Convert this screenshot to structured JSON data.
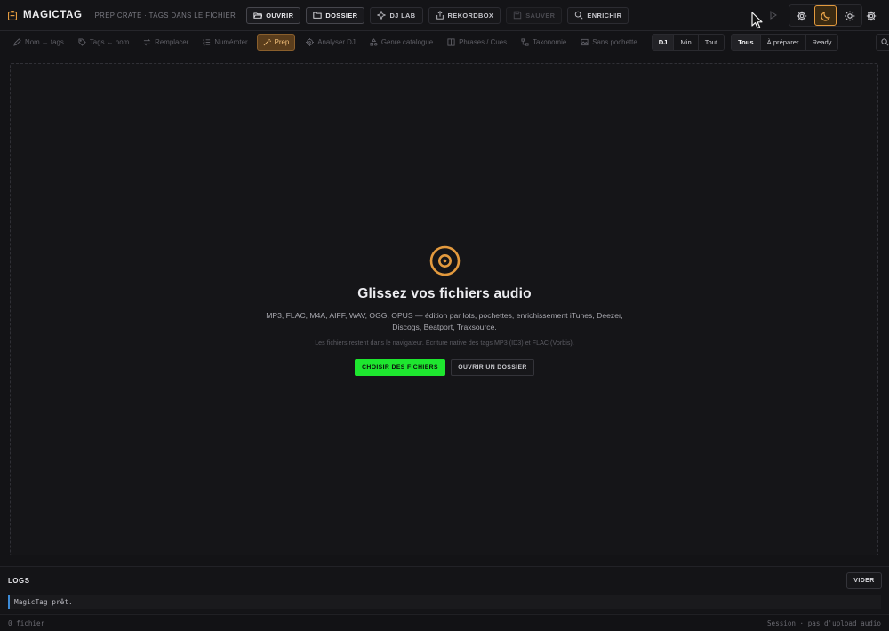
{
  "app": {
    "name": "MAGICTAG",
    "tagline": "PREP CRATE · TAGS DANS LE FICHIER"
  },
  "topbar": {
    "buttons": [
      {
        "label": "OUVRIR",
        "icon": "folder-open-icon",
        "state": "strong"
      },
      {
        "label": "DOSSIER",
        "icon": "folder-icon",
        "state": "strong"
      },
      {
        "label": "DJ LAB",
        "icon": "sparkle-icon",
        "state": "normal"
      },
      {
        "label": "REKORDBOX",
        "icon": "export-icon",
        "state": "normal"
      },
      {
        "label": "SAUVER",
        "icon": "save-icon",
        "state": "disabled"
      },
      {
        "label": "ENRICHIR",
        "icon": "magic-search-icon",
        "state": "normal"
      }
    ],
    "icon_group": [
      "gear-icon",
      "moon-icon",
      "sun-icon"
    ],
    "active_theme": "moon-icon",
    "settings_icon": "settings-icon"
  },
  "toolbar": {
    "tools": [
      {
        "label": "Nom ← tags",
        "icon": "pen-icon"
      },
      {
        "label": "Tags ← nom",
        "icon": "tag-icon"
      },
      {
        "label": "Remplacer",
        "icon": "replace-icon"
      },
      {
        "label": "Numéroter",
        "icon": "list-number-icon"
      },
      {
        "label": "Prep",
        "icon": "wand-icon",
        "active": true
      },
      {
        "label": "Analyser DJ",
        "icon": "target-icon"
      },
      {
        "label": "Genre catalogue",
        "icon": "shapes-icon"
      },
      {
        "label": "Phrases / Cues",
        "icon": "columns-icon"
      },
      {
        "label": "Taxonomie",
        "icon": "tree-icon"
      },
      {
        "label": "Sans pochette",
        "icon": "image-off-icon"
      }
    ],
    "view_modes": [
      "DJ",
      "Min",
      "Tout"
    ],
    "active_view": "DJ",
    "filters": [
      "Tous",
      "À préparer",
      "Ready"
    ],
    "active_filter": "Tous"
  },
  "dropzone": {
    "title": "Glissez vos fichiers audio",
    "description": "MP3, FLAC, M4A, AIFF, WAV, OGG, OPUS — édition par lots, pochettes, enrichissement iTunes, Deezer, Discogs, Beatport, Traxsource.",
    "note": "Les fichiers restent dans le navigateur. Écriture native des tags MP3 (ID3) et FLAC (Vorbis).",
    "choose_label": "CHOISIR DES FICHIERS",
    "folder_label": "OUVRIR UN DOSSIER"
  },
  "logs": {
    "title": "LOGS",
    "clear_label": "VIDER",
    "lines": [
      "MagicTag prêt."
    ]
  },
  "footer": {
    "file_count": "0 fichier",
    "session": "Session · pas d'upload audio"
  },
  "colors": {
    "accent": "#e39a3e",
    "primary_button": "#1ee62f",
    "background": "#131316",
    "log_marker": "#3c8ad6"
  }
}
